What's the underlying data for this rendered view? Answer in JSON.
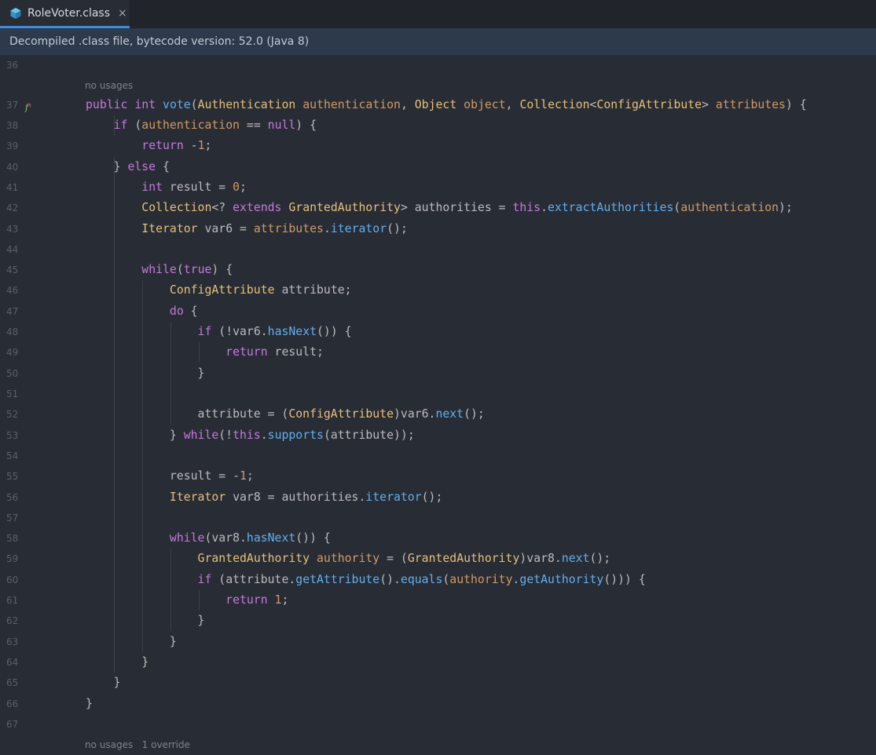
{
  "tab": {
    "label": "RoleVoter.class",
    "close": "×",
    "icon": "class-file-icon"
  },
  "banner": {
    "text": "Decompiled .class file, bytecode version: 52.0 (Java 8)"
  },
  "hints": {
    "first": "no usages",
    "second": "no usages   1 override"
  },
  "gutter": {
    "method_marker": "f"
  },
  "line_numbers": [
    "36",
    "37",
    "38",
    "39",
    "40",
    "41",
    "42",
    "43",
    "44",
    "45",
    "46",
    "47",
    "48",
    "49",
    "50",
    "51",
    "52",
    "53",
    "54",
    "55",
    "56",
    "57",
    "58",
    "59",
    "60",
    "61",
    "62",
    "63",
    "64",
    "65",
    "66",
    "67"
  ],
  "code_lines": [
    "",
    "public int vote(Authentication authentication, Object object, Collection<ConfigAttribute> attributes) {",
    "    if (authentication == null) {",
    "        return -1;",
    "    } else {",
    "        int result = 0;",
    "        Collection<? extends GrantedAuthority> authorities = this.extractAuthorities(authentication);",
    "        Iterator var6 = attributes.iterator();",
    "",
    "        while(true) {",
    "            ConfigAttribute attribute;",
    "            do {",
    "                if (!var6.hasNext()) {",
    "                    return result;",
    "                }",
    "",
    "                attribute = (ConfigAttribute)var6.next();",
    "            } while(!this.supports(attribute));",
    "",
    "            result = -1;",
    "            Iterator var8 = authorities.iterator();",
    "",
    "            while(var8.hasNext()) {",
    "                GrantedAuthority authority = (GrantedAuthority)var8.next();",
    "                if (attribute.getAttribute().equals(authority.getAuthority())) {",
    "                    return 1;",
    "                }",
    "            }",
    "        }",
    "    }",
    "}",
    ""
  ],
  "colors": {
    "keyword": "#c678dd",
    "type": "#e5c07b",
    "method": "#61afef",
    "parameter": "#d19a66",
    "plain": "#bbbbbb",
    "tab_accent": "#3d8bd9",
    "banner_bg": "#2c3a4c"
  }
}
